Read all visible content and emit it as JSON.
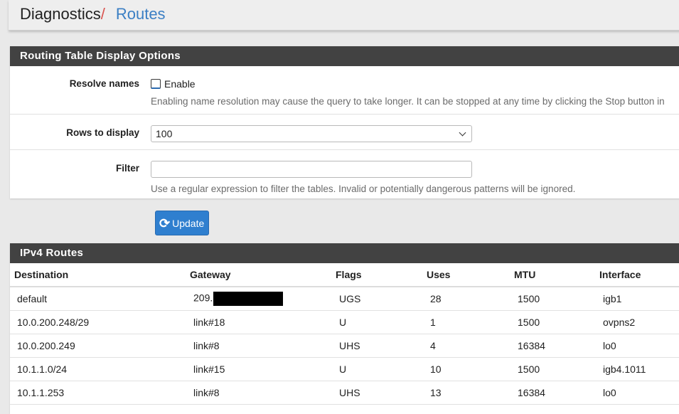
{
  "breadcrumb": {
    "root": "Diagnostics",
    "separator": "/",
    "page": "Routes"
  },
  "options_panel": {
    "title": "Routing Table Display Options",
    "resolve_names": {
      "label": "Resolve names",
      "checkbox_label": "Enable",
      "checked": false,
      "help": "Enabling name resolution may cause the query to take longer. It can be stopped at any time by clicking the Stop button in"
    },
    "rows_to_display": {
      "label": "Rows to display",
      "value": "100"
    },
    "filter": {
      "label": "Filter",
      "value": "",
      "help": "Use a regular expression to filter the tables. Invalid or potentially dangerous patterns will be ignored."
    },
    "update_button": "Update"
  },
  "ipv4_routes": {
    "title": "IPv4 Routes",
    "columns": [
      "Destination",
      "Gateway",
      "Flags",
      "Uses",
      "MTU",
      "Interface"
    ],
    "rows": [
      [
        "default",
        "209.",
        "UGS",
        "28",
        "1500",
        "igb1"
      ],
      [
        "10.0.200.248/29",
        "link#18",
        "U",
        "1",
        "1500",
        "ovpns2"
      ],
      [
        "10.0.200.249",
        "link#8",
        "UHS",
        "4",
        "16384",
        "lo0"
      ],
      [
        "10.1.1.0/24",
        "link#15",
        "U",
        "10",
        "1500",
        "igb4.1011"
      ],
      [
        "10.1.1.253",
        "link#8",
        "UHS",
        "13",
        "16384",
        "lo0"
      ]
    ]
  }
}
